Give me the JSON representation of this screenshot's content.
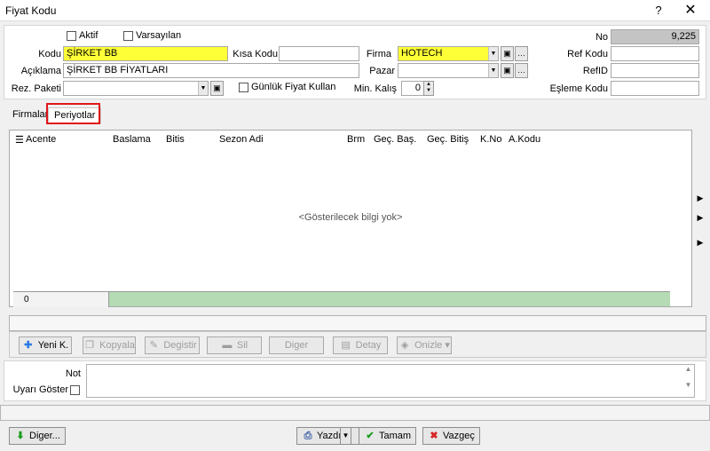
{
  "window": {
    "title": "Fiyat Kodu",
    "help": "?",
    "close": "✕"
  },
  "form": {
    "aktif_label": "Aktif",
    "varsayilan_label": "Varsayılan",
    "kodu_label": "Kodu",
    "kodu_value": "ŞİRKET BB",
    "aciklama_label": "Açıklama",
    "aciklama_value": "ŞİRKET BB FİYATLARI",
    "rez_paketi_label": "Rez. Paketi",
    "rez_paketi_value": "",
    "kisa_kodu_label": "Kısa Kodu",
    "kisa_kodu_value": "",
    "gunluk_label": "Günlük Fiyat Kullan",
    "firma_label": "Firma",
    "firma_value": "HOTECH",
    "pazar_label": "Pazar",
    "pazar_value": "",
    "min_kalis_label": "Min. Kalış",
    "min_kalis_value": "0",
    "no_label": "No",
    "no_value": "9,225",
    "ref_kodu_label": "Ref Kodu",
    "refid_label": "RefID",
    "esleme_label": "Eşleme Kodu"
  },
  "tabs": [
    {
      "label": "Firmalar"
    },
    {
      "label": "Periyotlar"
    }
  ],
  "grid": {
    "columns": [
      "Acente",
      "Baslama",
      "Bitis",
      "Sezon Adi",
      "Brm",
      "Geç. Baş.",
      "Geç. Bitiş",
      "K.No",
      "A.Kodu"
    ],
    "empty_text": "<Gösterilecek bilgi yok>",
    "footer_count": "0"
  },
  "toolbar": {
    "yeni": "Yeni K.",
    "kopyala": "Kopyala",
    "degistir": "Degistir",
    "sil": "Sil",
    "diger": "Diger",
    "detay": "Detay",
    "onizle": "Onizle"
  },
  "note": {
    "not_label": "Not",
    "uyari_label": "Uyarı Göster"
  },
  "bottom": {
    "diger": "Diger...",
    "yazdir": "Yazdır",
    "tamam": "Tamam",
    "vazgec": "Vazgeç"
  },
  "colors": {
    "highlight_yellow": "#ffff38",
    "tab_outline": "#e0161a",
    "footer_green": "#b4dbb3"
  }
}
